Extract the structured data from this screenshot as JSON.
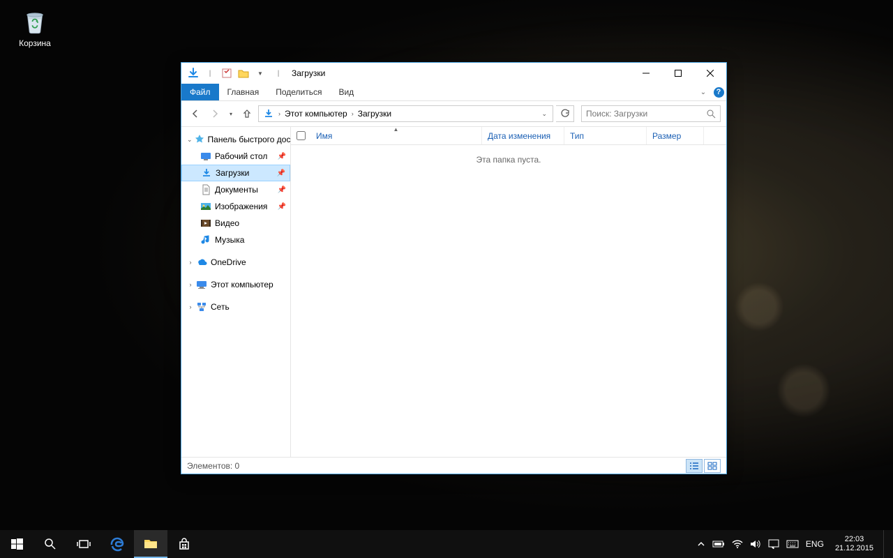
{
  "desktop": {
    "recycle_bin": "Корзина"
  },
  "window": {
    "title": "Загрузки",
    "tabs": {
      "file": "Файл",
      "home": "Главная",
      "share": "Поделиться",
      "view": "Вид"
    },
    "breadcrumb": {
      "this_pc": "Этот компьютер",
      "downloads": "Загрузки"
    },
    "search_placeholder": "Поиск: Загрузки",
    "columns": {
      "name": "Имя",
      "date": "Дата изменения",
      "type": "Тип",
      "size": "Размер"
    },
    "empty_text": "Эта папка пуста.",
    "status": "Элементов: 0"
  },
  "nav": {
    "quick_access": "Панель быстрого доступа",
    "items": {
      "desktop": "Рабочий стол",
      "downloads": "Загрузки",
      "documents": "Документы",
      "pictures": "Изображения",
      "videos": "Видео",
      "music": "Музыка"
    },
    "onedrive": "OneDrive",
    "this_pc": "Этот компьютер",
    "network": "Сеть"
  },
  "taskbar": {
    "lang": "ENG",
    "time": "22:03",
    "date": "21.12.2015"
  }
}
